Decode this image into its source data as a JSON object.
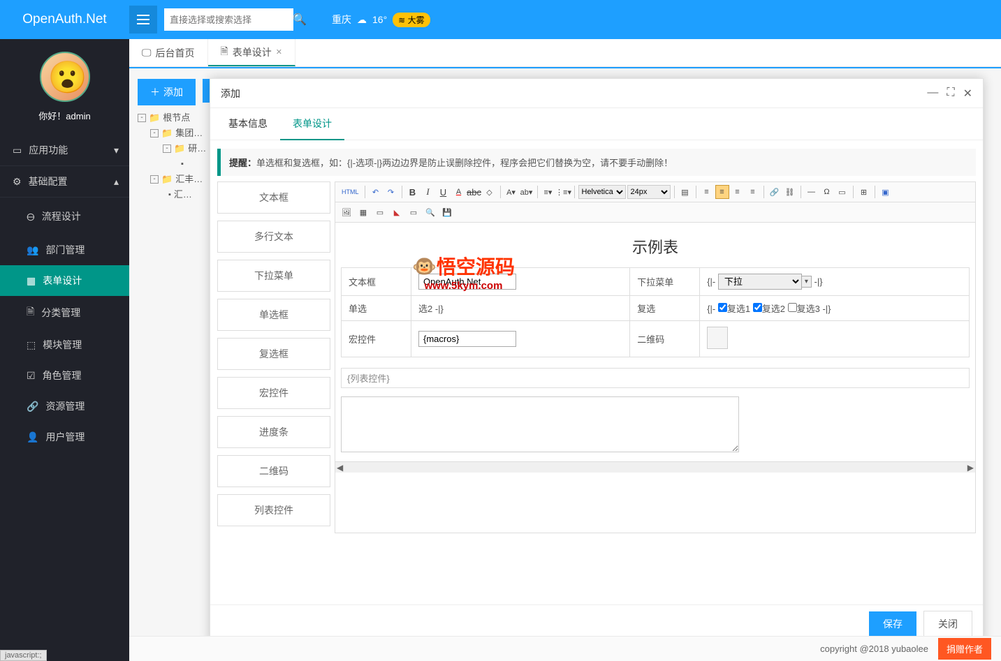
{
  "header": {
    "logo": "OpenAuth.Net",
    "search_placeholder": "直接选择或搜索选择",
    "weather": {
      "city": "重庆",
      "temp": "16°",
      "badge_icon": "≋",
      "badge": "大雾"
    }
  },
  "sidebar": {
    "greeting": "你好！admin",
    "items": [
      {
        "icon": "▭",
        "label": "应用功能",
        "chev": "▾"
      },
      {
        "icon": "⚙",
        "label": "基础配置",
        "chev": "▴",
        "open": true,
        "children": [
          {
            "icon": "🜔",
            "label": "流程设计"
          },
          {
            "icon": "👥",
            "label": "部门管理"
          },
          {
            "icon": "▦",
            "label": "表单设计",
            "active": true
          },
          {
            "icon": "🗎",
            "label": "分类管理"
          },
          {
            "icon": "⬚",
            "label": "模块管理"
          },
          {
            "icon": "☑",
            "label": "角色管理"
          },
          {
            "icon": "🔗",
            "label": "资源管理"
          },
          {
            "icon": "👤",
            "label": "用户管理"
          }
        ]
      }
    ]
  },
  "tabs": {
    "items": [
      {
        "icon": "🖵",
        "label": "后台首页",
        "close": false
      },
      {
        "icon": "🗎",
        "label": "表单设计",
        "close": true,
        "active": true
      }
    ]
  },
  "toolbar": {
    "add": "添加"
  },
  "tree": {
    "rows": [
      {
        "indent": 0,
        "toggle": "-",
        "icon": "📁",
        "label": "根节点"
      },
      {
        "indent": 1,
        "toggle": "-",
        "icon": "📁",
        "label": "集团…"
      },
      {
        "indent": 2,
        "toggle": "-",
        "icon": "📁",
        "label": "研…"
      },
      {
        "indent": 3,
        "toggle": "",
        "icon": "▪",
        "label": ""
      },
      {
        "indent": 1,
        "toggle": "-",
        "icon": "📁",
        "label": "汇丰…"
      },
      {
        "indent": 2,
        "toggle": "",
        "icon": "▪",
        "label": "汇…"
      }
    ]
  },
  "modal": {
    "title": "添加",
    "subtabs": {
      "basic": "基本信息",
      "design": "表单设计"
    },
    "alert_label": "提醒：",
    "alert": "单选框和复选框，如：{|-选项-|}两边边界是防止误删除控件，程序会把它们替换为空，请不要手动删除！",
    "components": [
      "文本框",
      "多行文本",
      "下拉菜单",
      "单选框",
      "复选框",
      "宏控件",
      "进度条",
      "二维码",
      "列表控件"
    ],
    "editor_toolbar": {
      "font": "Helvetica N",
      "size": "24px"
    },
    "form": {
      "title": "示例表",
      "r1": {
        "c1": "文本框",
        "v1": "OpenAuth.Net",
        "c2": "下拉菜单",
        "v2_pre": "{|-",
        "v2_sel": "下拉",
        "v2_post": "-|}"
      },
      "r2": {
        "c1": "单选",
        "v1": "选2 -|}",
        "c2": "复选",
        "v2_pre": "{|-",
        "cb1": "复选1",
        "cb2": "复选2",
        "cb3": "复选3",
        "v2_post": "-|}"
      },
      "r3": {
        "c1": "宏控件",
        "v1": "{macros}",
        "c2": "二维码"
      },
      "list": "{列表控件}"
    },
    "buttons": {
      "save": "保存",
      "close": "关闭"
    }
  },
  "footer": {
    "copyright": "copyright @2018 yubaolee",
    "donate": "捐赠作者"
  },
  "status": "javascript:;",
  "watermark": {
    "text": "悟空源码",
    "url": "www.5kym.com"
  }
}
